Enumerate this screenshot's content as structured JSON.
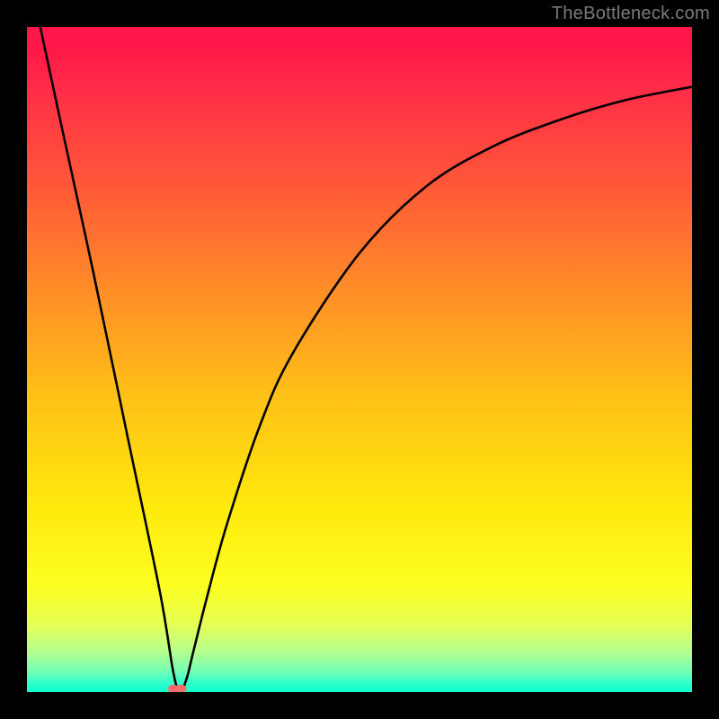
{
  "watermark": "TheBottleneck.com",
  "chart_data": {
    "type": "line",
    "title": "",
    "xlabel": "",
    "ylabel": "",
    "xlim": [
      0,
      100
    ],
    "ylim": [
      0,
      100
    ],
    "grid": false,
    "legend": false,
    "background_gradient": {
      "top": "#ff1749",
      "mid_upper": "#ff8e27",
      "mid_lower": "#ffe90c",
      "bottom": "#0cffc8"
    },
    "curve": {
      "stroke": "#000000",
      "minimum_x": 23,
      "minimum_y": 0,
      "points": [
        {
          "x": 2,
          "y": 100
        },
        {
          "x": 5,
          "y": 86
        },
        {
          "x": 10,
          "y": 63
        },
        {
          "x": 15,
          "y": 39
        },
        {
          "x": 20,
          "y": 15
        },
        {
          "x": 22,
          "y": 3
        },
        {
          "x": 23,
          "y": 0
        },
        {
          "x": 24,
          "y": 2
        },
        {
          "x": 25,
          "y": 6
        },
        {
          "x": 27,
          "y": 14
        },
        {
          "x": 30,
          "y": 25
        },
        {
          "x": 35,
          "y": 40
        },
        {
          "x": 40,
          "y": 51
        },
        {
          "x": 50,
          "y": 66
        },
        {
          "x": 60,
          "y": 76
        },
        {
          "x": 70,
          "y": 82
        },
        {
          "x": 80,
          "y": 86
        },
        {
          "x": 90,
          "y": 89
        },
        {
          "x": 100,
          "y": 91
        }
      ]
    },
    "marker": {
      "x": 22.5,
      "y": 0.5,
      "color": "#ff6b6b",
      "shape": "double-dot"
    }
  }
}
